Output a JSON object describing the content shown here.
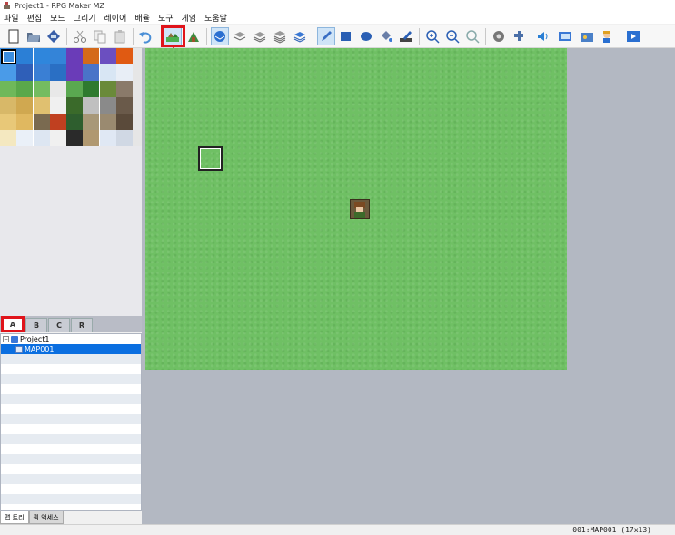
{
  "window": {
    "title": "Project1 - RPG Maker MZ"
  },
  "menu": [
    "파일",
    "편집",
    "모드",
    "그리기",
    "레이어",
    "배율",
    "도구",
    "게임",
    "도움말"
  ],
  "tileset_tabs": [
    {
      "label": "A",
      "active": true
    },
    {
      "label": "B",
      "active": false
    },
    {
      "label": "C",
      "active": false
    },
    {
      "label": "R",
      "active": false
    }
  ],
  "map_tree": {
    "project": "Project1",
    "maps": [
      "MAP001"
    ],
    "selected": "MAP001"
  },
  "bottom_tabs": [
    {
      "label": "맵 트리",
      "active": true
    },
    {
      "label": "퀵 액세스",
      "active": false
    }
  ],
  "status": {
    "map_info": "001:MAP001 (17x13)"
  },
  "toolbar": {
    "highlighted_button": "map-mode-button",
    "icons": [
      "new-project-icon",
      "open-project-icon",
      "save-project-icon",
      "cut-icon",
      "copy-icon",
      "paste-icon",
      "undo-icon",
      "map-mode-icon",
      "event-mode-icon",
      "layer-1-icon",
      "layer-2-icon",
      "layer-3-icon",
      "layer-4-icon",
      "all-layers-icon",
      "pencil-icon",
      "rectangle-icon",
      "ellipse-icon",
      "fill-icon",
      "shadow-pen-icon",
      "zoom-in-icon",
      "zoom-out-icon",
      "zoom-actual-icon",
      "database-icon",
      "plugin-manager-icon",
      "sound-test-icon",
      "event-searcher-icon",
      "resource-manager-icon",
      "character-generator-icon",
      "playtest-icon"
    ]
  },
  "colors": {
    "grass": "#6fc064",
    "highlight": "#e0141b",
    "selection": "#0a6ee0",
    "map_background": "#b3b8c2"
  }
}
